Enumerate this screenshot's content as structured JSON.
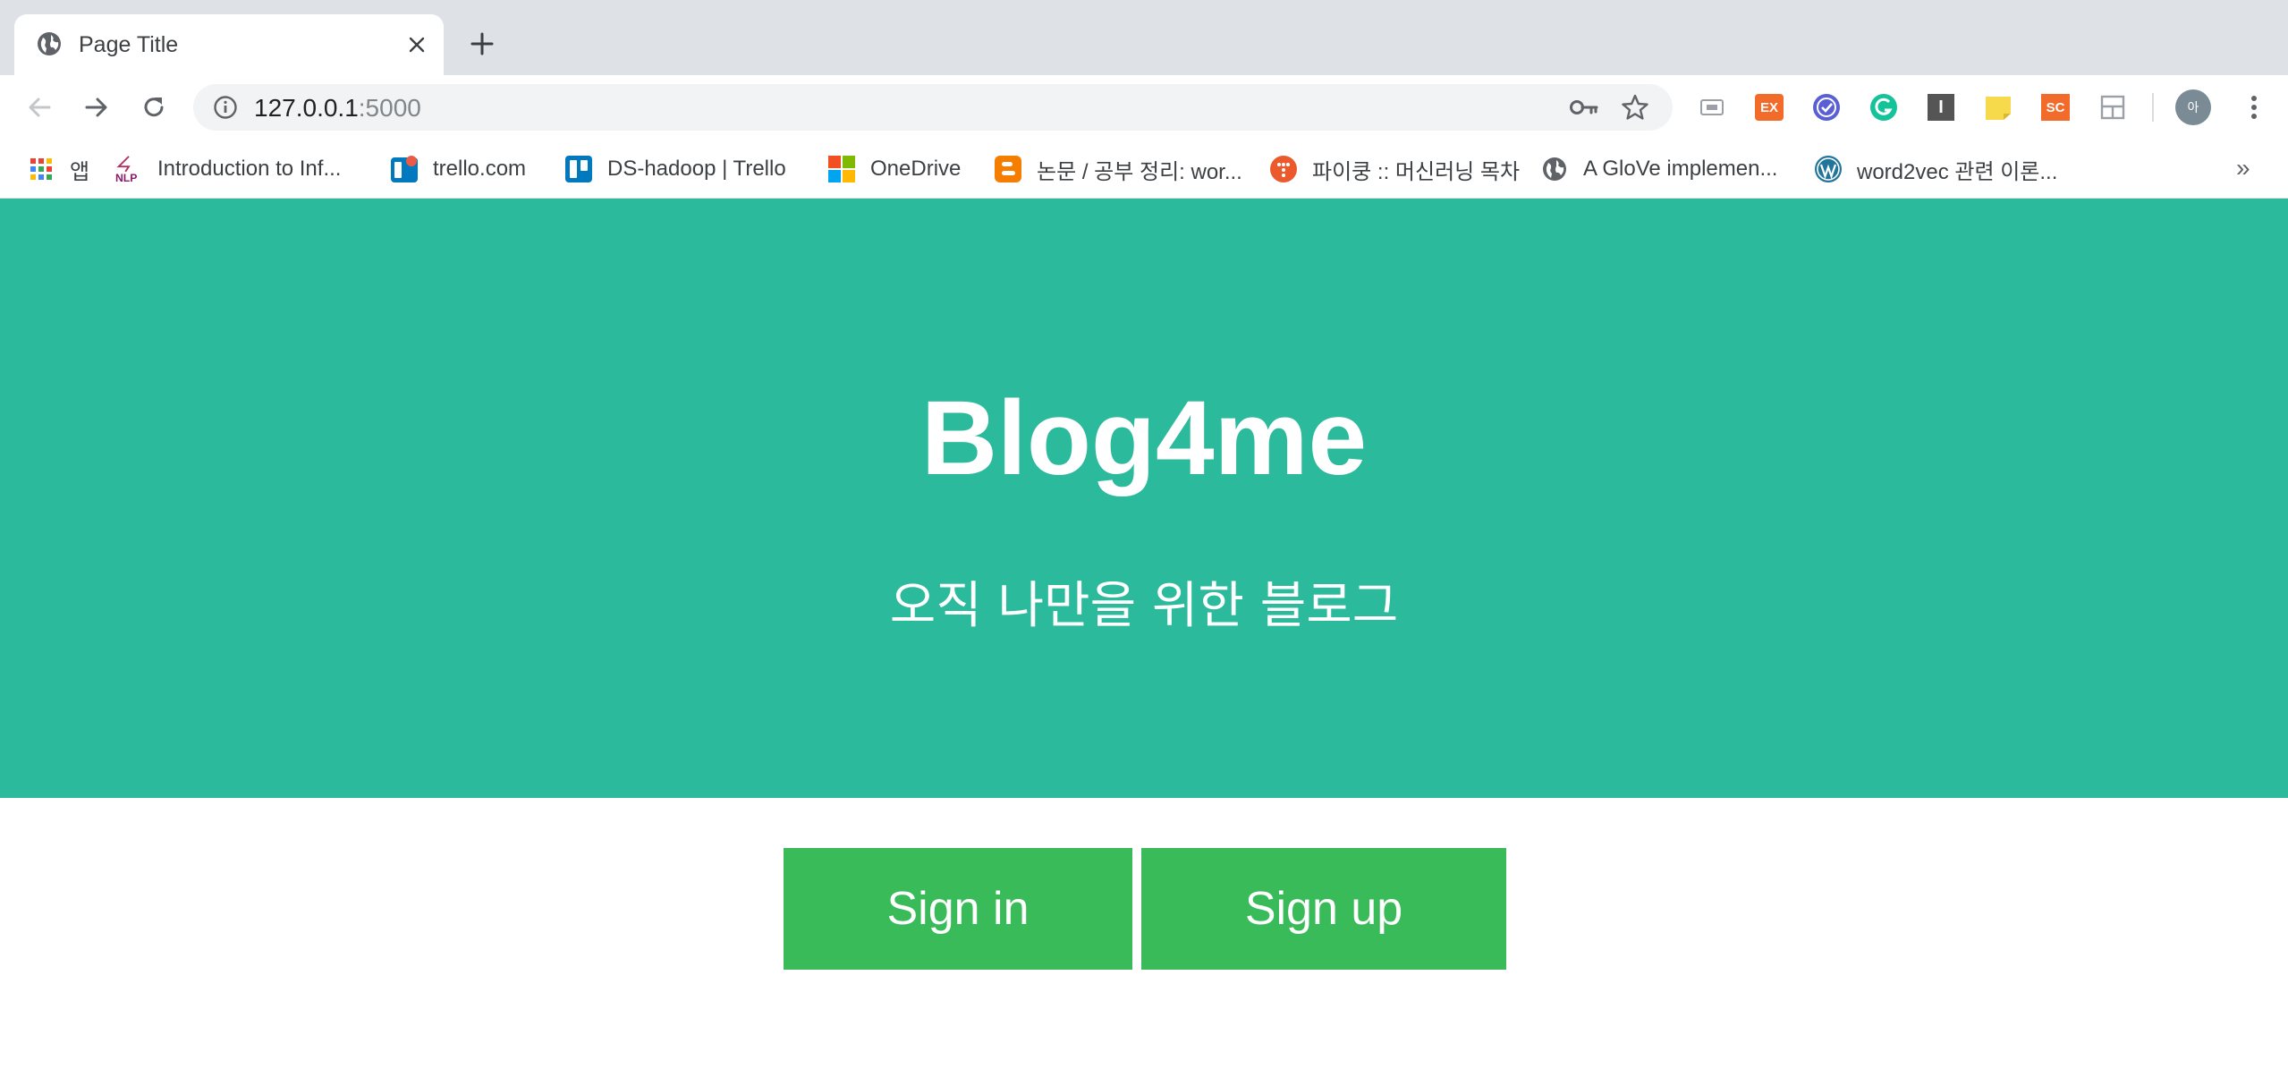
{
  "browser": {
    "tab": {
      "title": "Page Title",
      "favicon": "globe-icon"
    },
    "new_tab_symbol": "+",
    "address": {
      "host": "127.0.0.1",
      "port": ":5000"
    },
    "extensions": [
      {
        "name": "media-icon",
        "label": ""
      },
      {
        "name": "ex-extension-icon",
        "label": "EX",
        "color": "#f26b2a"
      },
      {
        "name": "check-extension-icon",
        "label": "",
        "color": "#5b5fd6"
      },
      {
        "name": "grammarly-icon",
        "label": "",
        "color": "#15c39a"
      },
      {
        "name": "i-extension-icon",
        "label": "I",
        "color": "#555555"
      },
      {
        "name": "sticky-note-icon",
        "label": "",
        "color": "#f7d94c"
      },
      {
        "name": "sc-extension-icon",
        "label": "SC",
        "color": "#f26b2a"
      },
      {
        "name": "layout-extension-icon",
        "label": ""
      }
    ],
    "profile_initial": "아"
  },
  "bookmarks": [
    {
      "icon": "apps-grid-icon",
      "label": "앱"
    },
    {
      "icon": "nlp-icon",
      "label": "Introduction to Inf..."
    },
    {
      "icon": "trello-icon",
      "label": "trello.com"
    },
    {
      "icon": "trello-board-icon",
      "label": "DS-hadoop | Trello"
    },
    {
      "icon": "microsoft-icon",
      "label": "OneDrive"
    },
    {
      "icon": "blogger-icon",
      "label": "논문 / 공부 정리: wor..."
    },
    {
      "icon": "pycon-icon",
      "label": "파이쿵 :: 머신러닝 목차"
    },
    {
      "icon": "globe-icon",
      "label": "A GloVe implemen..."
    },
    {
      "icon": "wordpress-icon",
      "label": "word2vec 관련 이론..."
    }
  ],
  "bookmarks_more": "»",
  "page": {
    "title": "Blog4me",
    "subtitle": "오직 나만을 위한 블로그",
    "signin_label": "Sign in",
    "signup_label": "Sign up"
  },
  "colors": {
    "hero": "#2bba9b",
    "button": "#38bb58"
  }
}
